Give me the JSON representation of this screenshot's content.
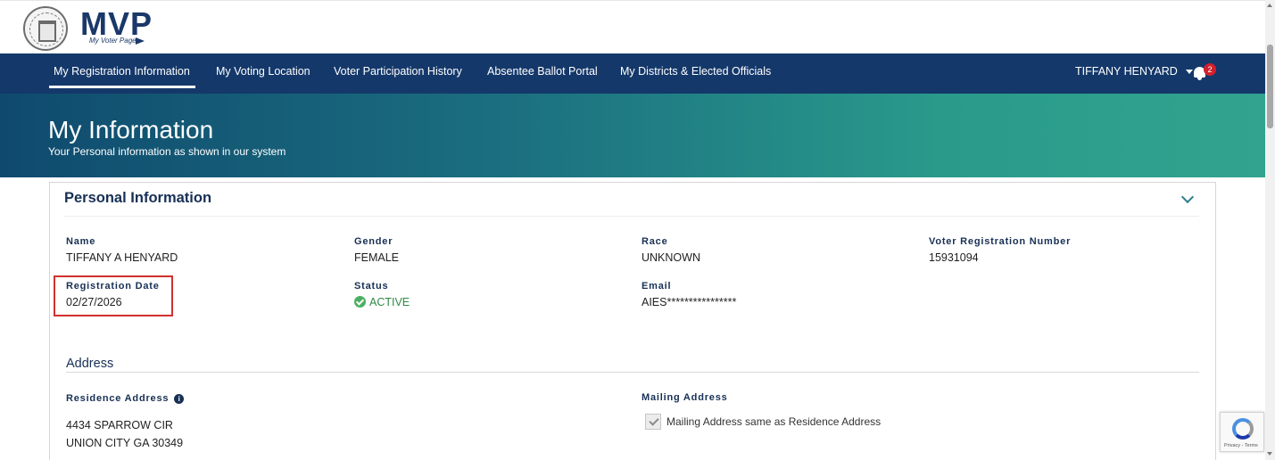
{
  "header": {
    "logo_text": "MVP",
    "logo_subtitle": "My Voter Page"
  },
  "nav": {
    "items": [
      {
        "label": "My Registration Information",
        "active": true
      },
      {
        "label": "My Voting Location"
      },
      {
        "label": "Voter Participation History"
      },
      {
        "label": "Absentee Ballot Portal"
      },
      {
        "label": "My Districts & Elected Officials"
      }
    ],
    "user_name": "TIFFANY HENYARD",
    "notification_count": "2"
  },
  "hero": {
    "title": "My Information",
    "subtitle": "Your Personal information as shown in our system"
  },
  "personal_info": {
    "title": "Personal Information",
    "fields": {
      "name": {
        "label": "Name",
        "value": "TIFFANY A HENYARD"
      },
      "gender": {
        "label": "Gender",
        "value": "FEMALE"
      },
      "race": {
        "label": "Race",
        "value": "UNKNOWN"
      },
      "voter_reg_number": {
        "label": "Voter Registration Number",
        "value": "15931094"
      },
      "registration_date": {
        "label": "Registration Date",
        "value": "02/27/2026"
      },
      "status": {
        "label": "Status",
        "value": "ACTIVE"
      },
      "email": {
        "label": "Email",
        "value": "AIES****************"
      }
    }
  },
  "address": {
    "title": "Address",
    "residence_label": "Residence Address",
    "residence_line1": "4434 SPARROW CIR",
    "residence_line2": "UNION CITY GA 30349",
    "mailing_label": "Mailing Address",
    "mailing_same_label": "Mailing Address same as Residence Address"
  },
  "recaptcha": {
    "footer_text": "Privacy - Terms"
  },
  "colors": {
    "nav_bg": "#14386a",
    "hero_start": "#0f4a6e",
    "hero_end": "#31a38e",
    "highlight": "#d0312d",
    "status_active": "#2e8a44"
  }
}
